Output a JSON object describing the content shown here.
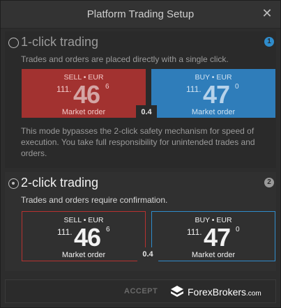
{
  "window": {
    "title": "Platform Trading Setup",
    "close_icon": "close-icon"
  },
  "option1": {
    "title": "1-click trading",
    "badge": "1",
    "description": "Trades and orders are placed directly with a single click.",
    "sell": {
      "label": "SELL • EUR",
      "prefix": "111.",
      "big": "46",
      "sup": "6",
      "order": "Market order"
    },
    "buy": {
      "label": "BUY • EUR",
      "prefix": "111.",
      "big": "47",
      "sup": "0",
      "order": "Market order"
    },
    "spread": "0.4",
    "warning": "This mode bypasses the 2-click safety mechanism for speed of execution. You take full responsibility for unintended trades and orders.",
    "selected": false
  },
  "option2": {
    "title": "2-click trading",
    "badge": "2",
    "description": "Trades and orders require confirmation.",
    "sell": {
      "label": "SELL • EUR",
      "prefix": "111.",
      "big": "46",
      "sup": "6",
      "order": "Market order"
    },
    "buy": {
      "label": "BUY • EUR",
      "prefix": "111.",
      "big": "47",
      "sup": "0",
      "order": "Market order"
    },
    "spread": "0.4",
    "selected": true
  },
  "footer": {
    "accept_label": "ACCEPT",
    "watermark_main": "ForexBrokers",
    "watermark_suffix": ".com"
  },
  "colors": {
    "sell_fill": "#a23230",
    "buy_fill": "#2f7dba",
    "sell_border": "#b73230",
    "buy_border": "#2f8ccc"
  }
}
